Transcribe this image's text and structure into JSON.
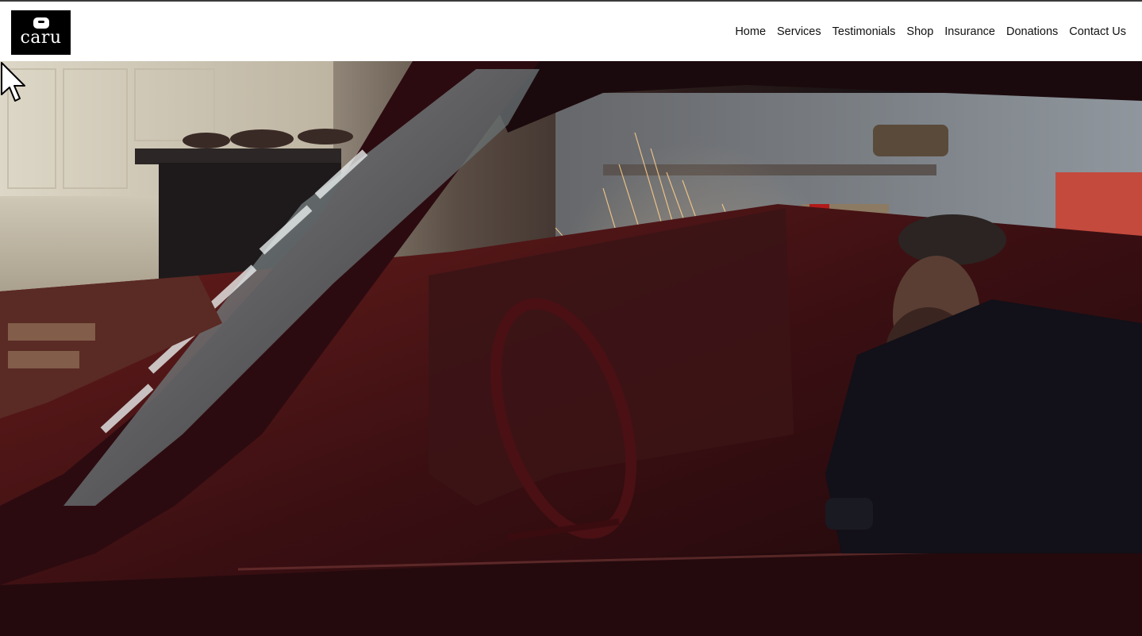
{
  "brand": {
    "logo_text": "caru"
  },
  "nav": {
    "items": [
      {
        "label": "Home"
      },
      {
        "label": "Services"
      },
      {
        "label": "Testimonials"
      },
      {
        "label": "Shop"
      },
      {
        "label": "Insurance"
      },
      {
        "label": "Donations"
      },
      {
        "label": "Contact Us"
      }
    ]
  },
  "colors": {
    "header_bg": "#ffffff",
    "logo_bg": "#000000",
    "nav_text": "#111111"
  },
  "icons": {
    "logo": "car-icon",
    "pointer": "mouse-cursor-icon"
  }
}
